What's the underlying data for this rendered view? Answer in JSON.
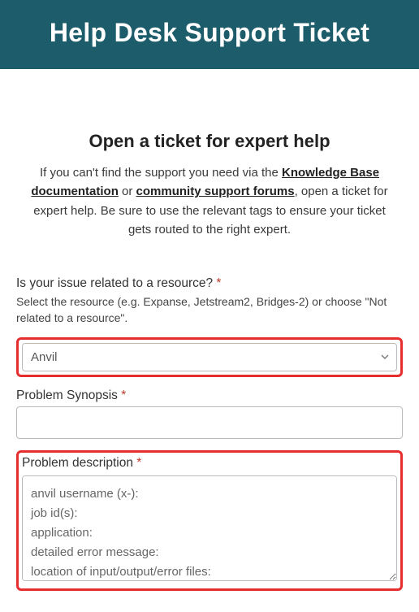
{
  "banner": {
    "title": "Help Desk Support Ticket"
  },
  "section": {
    "heading": "Open a ticket for expert help",
    "intro_pre": "If you can't find the support you need via the ",
    "link_kb": "Knowledge Base documentation",
    "intro_mid": " or ",
    "link_forums": "community support forums",
    "intro_post": ", open a ticket for expert help. Be sure to use the relevant tags to ensure your ticket gets routed to the right expert."
  },
  "fields": {
    "resource": {
      "label": "Is your issue related to a resource?",
      "helper": "Select the resource (e.g. Expanse, Jetstream2, Bridges-2) or choose \"Not related to a resource\".",
      "value": "Anvil"
    },
    "synopsis": {
      "label": "Problem Synopsis",
      "value": ""
    },
    "description": {
      "label": "Problem description",
      "value": "anvil username (x-):\njob id(s):\napplication:\ndetailed error message:\nlocation of input/output/error files:"
    }
  }
}
